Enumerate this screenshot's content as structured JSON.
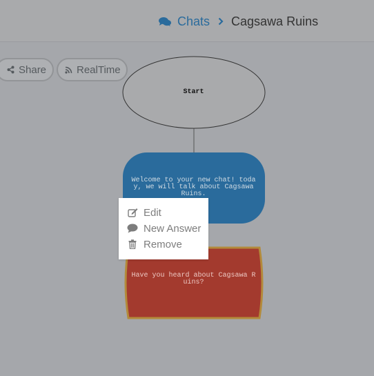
{
  "header": {
    "breadcrumb_root": "Chats",
    "breadcrumb_current": "Cagsawa Ruins",
    "icons": {
      "chats": "comments-icon",
      "separator": "chevron-right-icon"
    }
  },
  "toolbar": {
    "share_label": "Share",
    "realtime_label": "RealTime",
    "icons": {
      "share": "share-icon",
      "realtime": "rss-icon"
    }
  },
  "flow": {
    "start_label": "Start",
    "nodes": [
      {
        "type": "bot-message",
        "text": "Welcome to your new chat! today, we will talk about Cagsawa Ruins.",
        "color": "#2a6b9c"
      },
      {
        "type": "question",
        "text": "Have you heard about Cagsawa Ruins?",
        "color": "#a33a2e",
        "border": "#b38a3a"
      }
    ]
  },
  "context_menu": {
    "items": [
      {
        "label": "Edit",
        "icon": "edit-icon"
      },
      {
        "label": "New Answer",
        "icon": "comment-icon"
      },
      {
        "label": "Remove",
        "icon": "trash-icon"
      }
    ]
  },
  "colors": {
    "background": "#a5a7ab",
    "accent": "#2a6b9c",
    "menu_text": "#7d7d7d"
  }
}
